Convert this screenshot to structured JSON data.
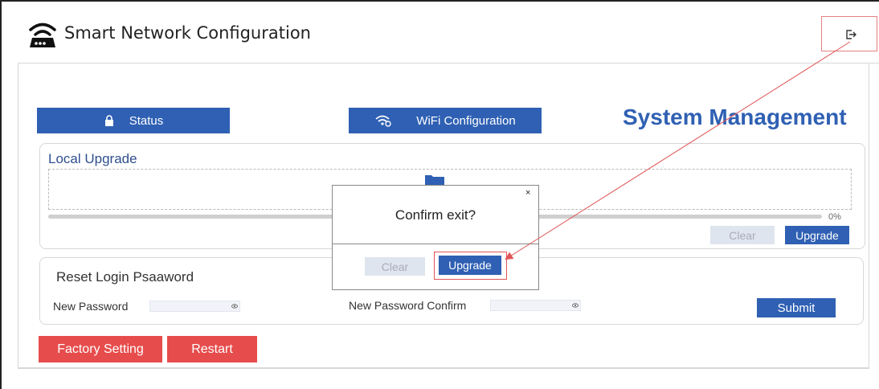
{
  "app": {
    "title": "Smart Network Configuration"
  },
  "nav": {
    "status_label": "Status",
    "wifi_label": "WiFi Configuration"
  },
  "page": {
    "title": "System Management"
  },
  "local_upgrade": {
    "title": "Local Upgrade",
    "progress_percent": 0,
    "progress_label": "0%",
    "clear_label": "Clear",
    "upgrade_label": "Upgrade"
  },
  "reset_password": {
    "title": "Reset Login Psaaword",
    "new_password_label": "New Password",
    "new_password_value": "",
    "confirm_label": "New Password Confirm",
    "confirm_value": "",
    "submit_label": "Submit"
  },
  "actions": {
    "factory_label": "Factory Setting",
    "restart_label": "Restart"
  },
  "modal": {
    "close_label": "×",
    "message": "Confirm exit?",
    "clear_label": "Clear",
    "upgrade_label": "Upgrade"
  },
  "icons": {
    "logo": "router-icon",
    "exit": "logout-icon",
    "status": "lock-icon",
    "wifi": "wifi-settings-icon",
    "folder": "folder-icon",
    "eye": "eye-icon"
  },
  "colors": {
    "primary": "#2f60b3",
    "danger": "#e74c4c",
    "annotation": "#e05555"
  }
}
